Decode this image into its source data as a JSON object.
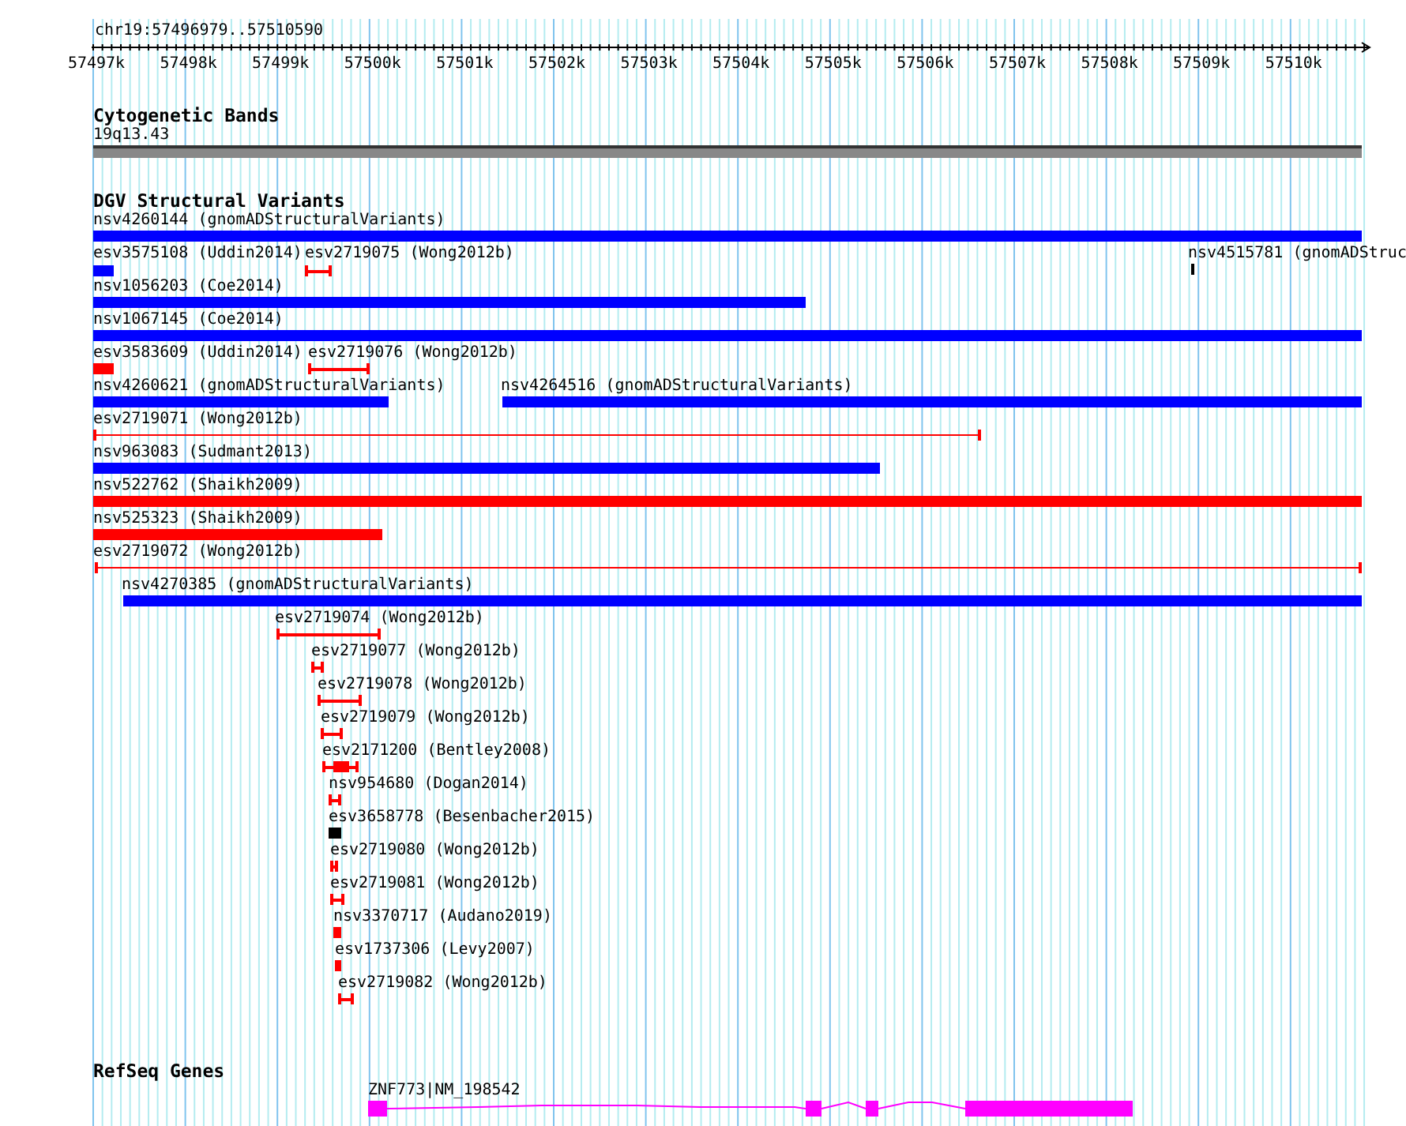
{
  "location": "chr19:57496979..57510590",
  "ruler_ticks": [
    "57497k",
    "57498k",
    "57499k",
    "57500k",
    "57501k",
    "57502k",
    "57503k",
    "57504k",
    "57505k",
    "57506k",
    "57507k",
    "57508k",
    "57509k",
    "57510k"
  ],
  "tracks": [
    {
      "title": "Cytogenetic Bands",
      "kind": "bands",
      "features": [
        {
          "label": "19q13.43"
        }
      ]
    },
    {
      "title": "DGV Structural Variants",
      "kind": "variants",
      "features": [
        {
          "label": "nsv4260144 (gnomADStructuralVariants)",
          "kind": "bar",
          "color": "#0000ff"
        },
        {
          "label": "esv3575108 (Uddin2014)",
          "kind": "bar",
          "color": "#0000ff"
        },
        {
          "label": "esv2719075 (Wong2012b)",
          "kind": "span",
          "color": "#ff0000"
        },
        {
          "label": "nsv4515781 (gnomADStruc",
          "kind": "bar",
          "color": "#000000"
        },
        {
          "label": "nsv1056203 (Coe2014)",
          "kind": "bar",
          "color": "#0000ff"
        },
        {
          "label": "nsv1067145 (Coe2014)",
          "kind": "bar",
          "color": "#0000ff"
        },
        {
          "label": "esv3583609 (Uddin2014)",
          "kind": "bar",
          "color": "#ff0000"
        },
        {
          "label": "esv2719076 (Wong2012b)",
          "kind": "span",
          "color": "#ff0000"
        },
        {
          "label": "nsv4260621 (gnomADStructuralVariants)",
          "kind": "bar",
          "color": "#0000ff"
        },
        {
          "label": "nsv4264516 (gnomADStructuralVariants)",
          "kind": "bar",
          "color": "#0000ff"
        },
        {
          "label": "esv2719071 (Wong2012b)",
          "kind": "span",
          "color": "#ff0000"
        },
        {
          "label": "nsv963083 (Sudmant2013)",
          "kind": "bar",
          "color": "#0000ff"
        },
        {
          "label": "nsv522762 (Shaikh2009)",
          "kind": "bar",
          "color": "#ff0000"
        },
        {
          "label": "nsv525323 (Shaikh2009)",
          "kind": "bar",
          "color": "#ff0000"
        },
        {
          "label": "esv2719072 (Wong2012b)",
          "kind": "span",
          "color": "#ff0000"
        },
        {
          "label": "nsv4270385 (gnomADStructuralVariants)",
          "kind": "bar",
          "color": "#0000ff"
        },
        {
          "label": "esv2719074 (Wong2012b)",
          "kind": "span",
          "color": "#ff0000"
        },
        {
          "label": "esv2719077 (Wong2012b)",
          "kind": "span",
          "color": "#ff0000"
        },
        {
          "label": "esv2719078 (Wong2012b)",
          "kind": "span",
          "color": "#ff0000"
        },
        {
          "label": "esv2719079 (Wong2012b)",
          "kind": "span",
          "color": "#ff0000"
        },
        {
          "label": "esv2171200 (Bentley2008)",
          "kind": "compound",
          "color": "#ff0000"
        },
        {
          "label": "nsv954680 (Dogan2014)",
          "kind": "span",
          "color": "#ff0000"
        },
        {
          "label": "esv3658778 (Besenbacher2015)",
          "kind": "bar",
          "color": "#000000"
        },
        {
          "label": "esv2719080 (Wong2012b)",
          "kind": "span",
          "color": "#ff0000"
        },
        {
          "label": "esv2719081 (Wong2012b)",
          "kind": "span",
          "color": "#ff0000"
        },
        {
          "label": "nsv3370717 (Audano2019)",
          "kind": "bar",
          "color": "#ff0000"
        },
        {
          "label": "esv1737306 (Levy2007)",
          "kind": "bar",
          "color": "#ff0000"
        },
        {
          "label": "esv2719082 (Wong2012b)",
          "kind": "span",
          "color": "#ff0000"
        }
      ]
    },
    {
      "title": "RefSeq Genes",
      "kind": "genes",
      "features": [
        {
          "label": "ZNF773|NM_198542",
          "color": "#ff00ff"
        }
      ]
    }
  ]
}
